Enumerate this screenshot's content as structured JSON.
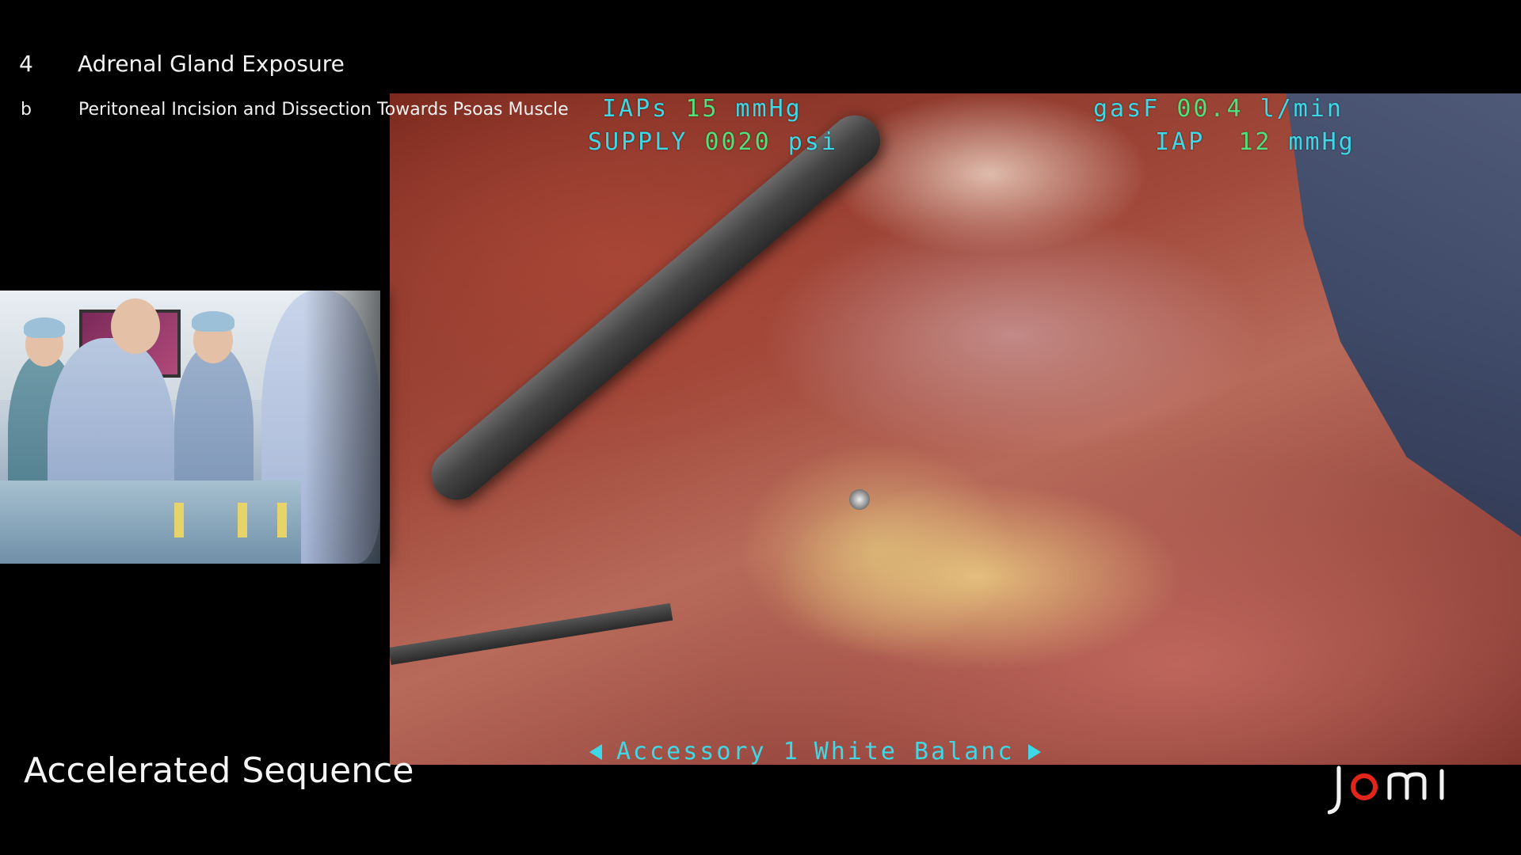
{
  "chapter": {
    "number": "4",
    "title": "Adrenal Gland Exposure"
  },
  "section": {
    "letter": "b",
    "title": "Peritoneal Incision and Dissection Towards Psoas Muscle"
  },
  "osd": {
    "iaps": {
      "label": "IAPs",
      "value": "15",
      "unit": "mmHg"
    },
    "supply": {
      "label": "SUPPLY",
      "value": "0020",
      "unit": "psi"
    },
    "gasf": {
      "label": "gasF",
      "value": "00.4",
      "unit": "l/min"
    },
    "iap": {
      "label": "IAP",
      "value": "12",
      "unit": "mmHg"
    },
    "menu": {
      "item": "Accessory 1",
      "setting": "White Balanc"
    }
  },
  "footer": {
    "sequence_label": "Accelerated Sequence",
    "logo_text": "jomi"
  },
  "colors": {
    "osd_label": "#3fd8e6",
    "osd_value": "#52e07a",
    "logo_accent": "#e2251b"
  },
  "icons": {
    "menu_left": "triangle-left-icon",
    "menu_right": "triangle-right-icon"
  }
}
